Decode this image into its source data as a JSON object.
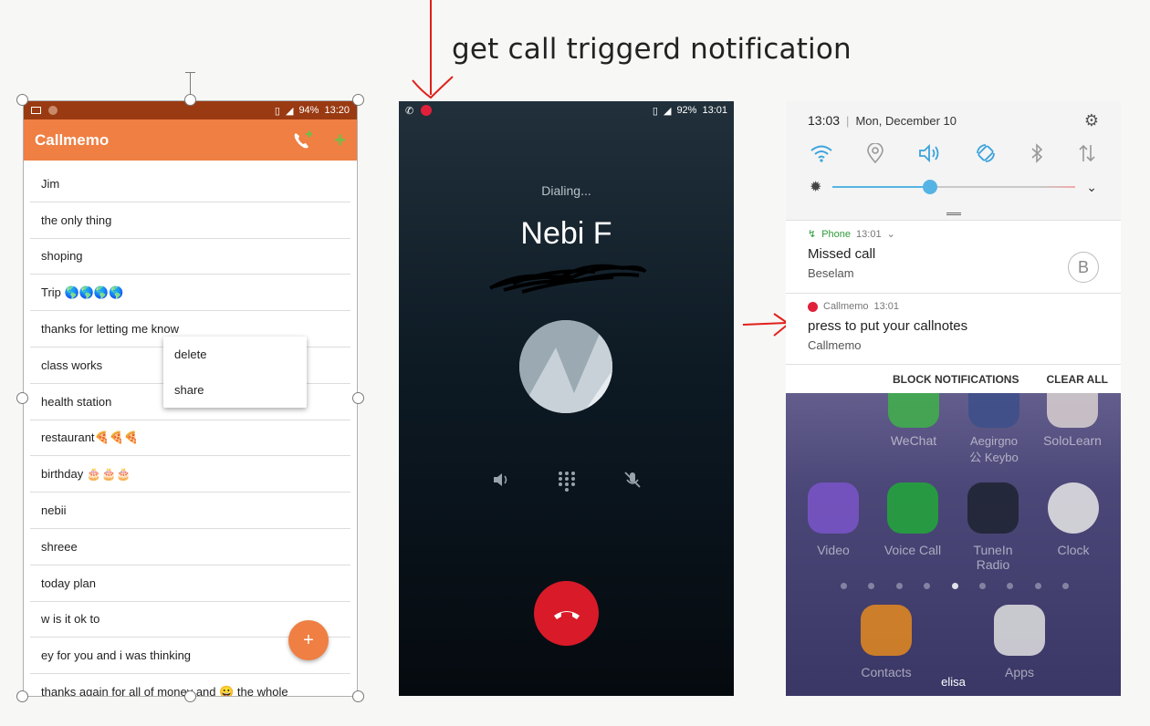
{
  "annotation": {
    "title": "get call triggerd notification"
  },
  "colors": {
    "accent": "#ef7f43",
    "status_bar": "#9a3a12",
    "end_call": "#d91a28",
    "slider": "#55b4e4"
  },
  "callmemo_app": {
    "status": {
      "battery": "94%",
      "time": "13:20"
    },
    "app_title": "Callmemo",
    "toolbar_icons": [
      "phone-refresh-icon",
      "add-icon"
    ],
    "notes": [
      "Jim",
      "the only thing",
      "shoping",
      "Trip 🌎🌎🌎🌎",
      "thanks for letting me know",
      "class works",
      "health station",
      "restaurant🍕🍕🍕",
      "birthday 🎂🎂🎂",
      "nebii",
      "shreee",
      "today plan",
      "w is it ok to",
      "ey for you and i was thinking",
      "thanks again for all of money and 😀 the whole"
    ],
    "context_menu": {
      "delete": "delete",
      "share": "share"
    },
    "fab_label": "+"
  },
  "dialer": {
    "status": {
      "battery": "92%",
      "time": "13:01"
    },
    "state": "Dialing...",
    "contact_name": "Nebi F",
    "controls": [
      "speaker-icon",
      "dialpad-icon",
      "mute-icon"
    ]
  },
  "notification_shade": {
    "time": "13:03",
    "date": "Mon, December 10",
    "quick_settings": [
      "wifi-icon",
      "location-icon",
      "sound-icon",
      "auto-rotate-icon",
      "bluetooth-icon",
      "mobile-data-icon"
    ],
    "brightness_level": 0.4,
    "notifications": [
      {
        "app": "Phone",
        "time": "13:01",
        "title": "Missed call",
        "text": "Beselam",
        "badge": "B"
      },
      {
        "app": "Callmemo",
        "time": "13:01",
        "title": "press to put your callnotes",
        "text": "Callmemo"
      }
    ],
    "actions": {
      "block": "BLOCK NOTIFICATIONS",
      "clear": "CLEAR ALL"
    },
    "home_apps_row1": [
      "WeChat",
      "Aegirgno\n公 Keybo",
      "SoloLearn"
    ],
    "home_apps_row2": [
      "Video",
      "Voice Call",
      "TuneIn Radio",
      "Clock"
    ],
    "dock_apps": [
      "Contacts",
      "Apps"
    ],
    "user_name": "elisa"
  }
}
